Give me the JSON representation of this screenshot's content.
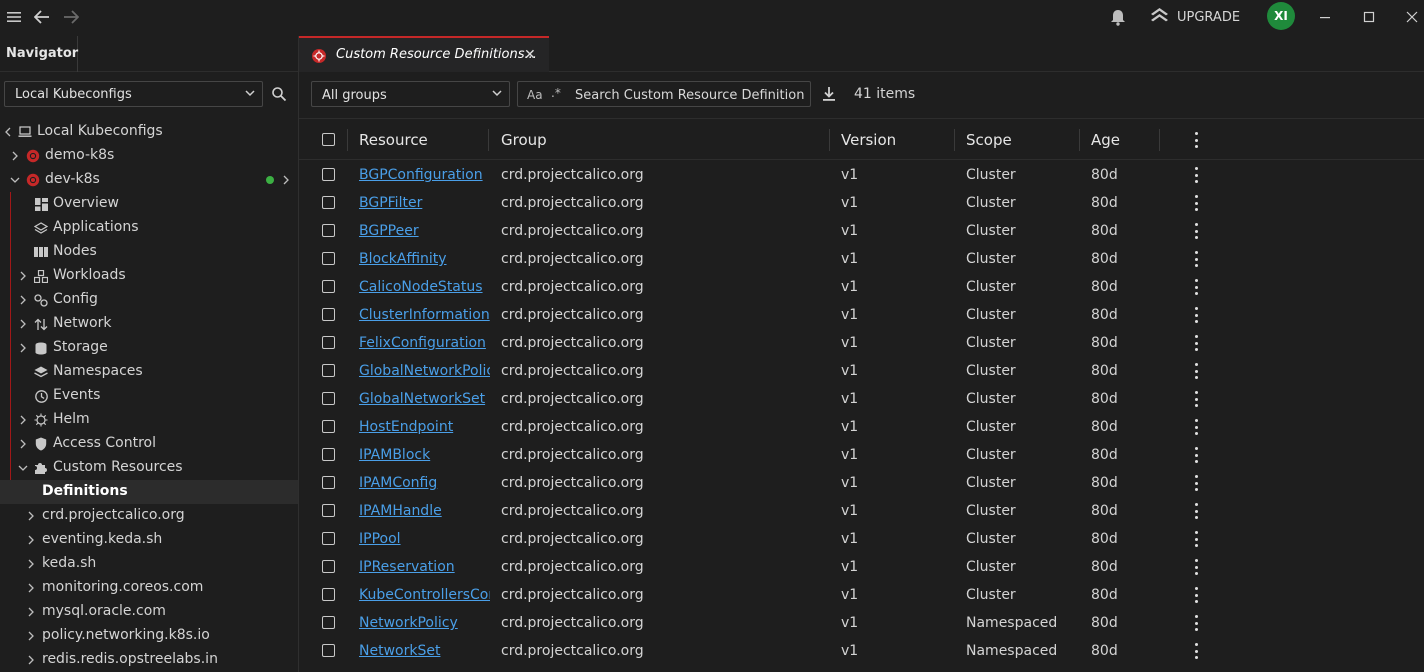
{
  "topbar": {
    "upgrade_label": "UPGRADE",
    "avatar_initials": "XI"
  },
  "navigator": {
    "tab_label": "Navigator",
    "context_select": "Local Kubeconfigs",
    "tree": [
      {
        "label": "Local Kubeconfigs",
        "icon": "laptop-icon",
        "level": 0,
        "caret": "left"
      },
      {
        "label": "demo-k8s",
        "icon": "cluster-icon",
        "level": 1,
        "caret": "right"
      },
      {
        "label": "dev-k8s",
        "icon": "cluster-icon",
        "level": 1,
        "caret": "down",
        "connected": true
      },
      {
        "label": "Overview",
        "icon": "overview-icon",
        "level": 2,
        "caret": ""
      },
      {
        "label": "Applications",
        "icon": "applications-icon",
        "level": 2,
        "caret": ""
      },
      {
        "label": "Nodes",
        "icon": "nodes-icon",
        "level": 2,
        "caret": ""
      },
      {
        "label": "Workloads",
        "icon": "workloads-icon",
        "level": 2,
        "caret": "right"
      },
      {
        "label": "Config",
        "icon": "config-icon",
        "level": 2,
        "caret": "right"
      },
      {
        "label": "Network",
        "icon": "network-icon",
        "level": 2,
        "caret": "right"
      },
      {
        "label": "Storage",
        "icon": "storage-icon",
        "level": 2,
        "caret": "right"
      },
      {
        "label": "Namespaces",
        "icon": "namespaces-icon",
        "level": 2,
        "caret": ""
      },
      {
        "label": "Events",
        "icon": "events-icon",
        "level": 2,
        "caret": ""
      },
      {
        "label": "Helm",
        "icon": "helm-icon",
        "level": 2,
        "caret": "right"
      },
      {
        "label": "Access Control",
        "icon": "shield-icon",
        "level": 2,
        "caret": "right"
      },
      {
        "label": "Custom Resources",
        "icon": "puzzle-icon",
        "level": 2,
        "caret": "down"
      },
      {
        "label": "Definitions",
        "icon": "",
        "level": 3,
        "caret": "",
        "active": true
      },
      {
        "label": "crd.projectcalico.org",
        "icon": "",
        "level": 3,
        "caret": "right"
      },
      {
        "label": "eventing.keda.sh",
        "icon": "",
        "level": 3,
        "caret": "right"
      },
      {
        "label": "keda.sh",
        "icon": "",
        "level": 3,
        "caret": "right"
      },
      {
        "label": "monitoring.coreos.com",
        "icon": "",
        "level": 3,
        "caret": "right"
      },
      {
        "label": "mysql.oracle.com",
        "icon": "",
        "level": 3,
        "caret": "right"
      },
      {
        "label": "policy.networking.k8s.io",
        "icon": "",
        "level": 3,
        "caret": "right"
      },
      {
        "label": "redis.redis.opstreelabs.in",
        "icon": "",
        "level": 3,
        "caret": "right"
      }
    ]
  },
  "tab": {
    "title": "Custom Resource Definitions...",
    "close": "✕"
  },
  "toolbar": {
    "groups_select": "All groups",
    "case_toggle": "Aa",
    "regex_toggle": ".*",
    "search_placeholder": "Search Custom Resource Definitions...",
    "item_count": "41 items"
  },
  "table": {
    "columns": [
      "Resource",
      "Group",
      "Version",
      "Scope",
      "Age"
    ],
    "rows": [
      [
        "BGPConfiguration",
        "crd.projectcalico.org",
        "v1",
        "Cluster",
        "80d"
      ],
      [
        "BGPFilter",
        "crd.projectcalico.org",
        "v1",
        "Cluster",
        "80d"
      ],
      [
        "BGPPeer",
        "crd.projectcalico.org",
        "v1",
        "Cluster",
        "80d"
      ],
      [
        "BlockAffinity",
        "crd.projectcalico.org",
        "v1",
        "Cluster",
        "80d"
      ],
      [
        "CalicoNodeStatus",
        "crd.projectcalico.org",
        "v1",
        "Cluster",
        "80d"
      ],
      [
        "ClusterInformation",
        "crd.projectcalico.org",
        "v1",
        "Cluster",
        "80d"
      ],
      [
        "FelixConfiguration",
        "crd.projectcalico.org",
        "v1",
        "Cluster",
        "80d"
      ],
      [
        "GlobalNetworkPolic",
        "crd.projectcalico.org",
        "v1",
        "Cluster",
        "80d"
      ],
      [
        "GlobalNetworkSet",
        "crd.projectcalico.org",
        "v1",
        "Cluster",
        "80d"
      ],
      [
        "HostEndpoint",
        "crd.projectcalico.org",
        "v1",
        "Cluster",
        "80d"
      ],
      [
        "IPAMBlock",
        "crd.projectcalico.org",
        "v1",
        "Cluster",
        "80d"
      ],
      [
        "IPAMConfig",
        "crd.projectcalico.org",
        "v1",
        "Cluster",
        "80d"
      ],
      [
        "IPAMHandle",
        "crd.projectcalico.org",
        "v1",
        "Cluster",
        "80d"
      ],
      [
        "IPPool",
        "crd.projectcalico.org",
        "v1",
        "Cluster",
        "80d"
      ],
      [
        "IPReservation",
        "crd.projectcalico.org",
        "v1",
        "Cluster",
        "80d"
      ],
      [
        "KubeControllersCor",
        "crd.projectcalico.org",
        "v1",
        "Cluster",
        "80d"
      ],
      [
        "NetworkPolicy",
        "crd.projectcalico.org",
        "v1",
        "Namespaced",
        "80d"
      ],
      [
        "NetworkSet",
        "crd.projectcalico.org",
        "v1",
        "Namespaced",
        "80d"
      ]
    ]
  },
  "colors": {
    "accent": "#c62828",
    "link": "#4a9fe8",
    "status_ok": "#3cb043",
    "avatar_bg": "#1f8a3b"
  }
}
